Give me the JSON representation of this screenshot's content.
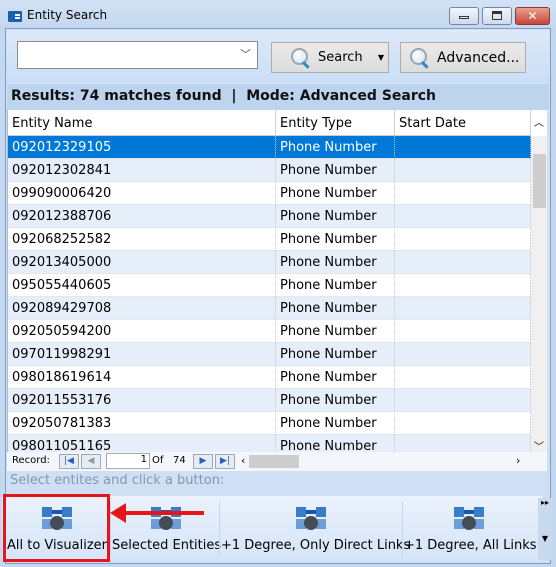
{
  "window": {
    "title": "Entity Search",
    "minimize": "minimize",
    "maximize": "maximize",
    "close": "✕"
  },
  "toolbar": {
    "search_value": "",
    "search_label": "Search",
    "advanced_label": "Advanced..."
  },
  "results": {
    "text": "Results: 74 matches found  |  Mode: Advanced Search"
  },
  "grid": {
    "columns": [
      "Entity Name",
      "Entity Type",
      "Start Date"
    ],
    "rows": [
      [
        "092012329105",
        "Phone Number",
        ""
      ],
      [
        "092012302841",
        "Phone Number",
        ""
      ],
      [
        "099090006420",
        "Phone Number",
        ""
      ],
      [
        "092012388706",
        "Phone Number",
        ""
      ],
      [
        "092068252582",
        "Phone Number",
        ""
      ],
      [
        "092013405000",
        "Phone Number",
        ""
      ],
      [
        "095055440605",
        "Phone Number",
        ""
      ],
      [
        "092089429708",
        "Phone Number",
        ""
      ],
      [
        "092050594200",
        "Phone Number",
        ""
      ],
      [
        "097011998291",
        "Phone Number",
        ""
      ],
      [
        "098018619614",
        "Phone Number",
        ""
      ],
      [
        "092011553176",
        "Phone Number",
        ""
      ],
      [
        "092050781383",
        "Phone Number",
        ""
      ],
      [
        "098011051165",
        "Phone Number",
        ""
      ]
    ],
    "selected_row": 0
  },
  "nav": {
    "record_label": "Record:",
    "current": "1",
    "of_label": "Of",
    "total": "74"
  },
  "status": "Select entites and click a button:",
  "actions": [
    {
      "label": "All to Visualizer"
    },
    {
      "label": "Selected Entities"
    },
    {
      "label": "+1 Degree, Only Direct Links"
    },
    {
      "label": "+1 Degree, All Links"
    }
  ],
  "colors": {
    "selection": "#0078d7",
    "highlight": "#e8141c",
    "accent": "#3a7cc8"
  }
}
